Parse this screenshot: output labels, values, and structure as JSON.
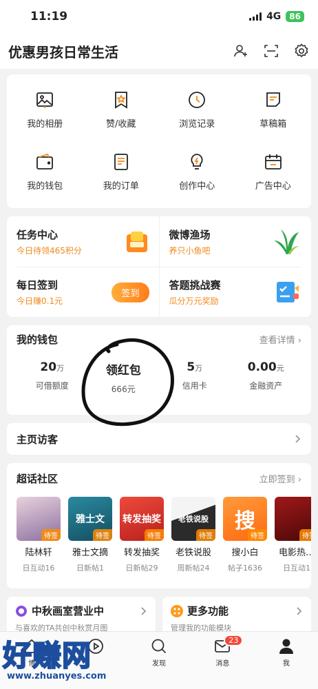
{
  "status": {
    "time": "11:19",
    "network": "4G",
    "battery": "86"
  },
  "header": {
    "title": "优惠男孩日常生活",
    "icons": [
      "add-friend-icon",
      "scan-icon",
      "settings-icon"
    ]
  },
  "grid": [
    [
      {
        "label": "我的相册",
        "icon": "photo-album-icon"
      },
      {
        "label": "赞/收藏",
        "icon": "favorite-icon"
      },
      {
        "label": "浏览记录",
        "icon": "history-icon"
      },
      {
        "label": "草稿箱",
        "icon": "drafts-icon"
      }
    ],
    [
      {
        "label": "我的钱包",
        "icon": "wallet-icon"
      },
      {
        "label": "我的订单",
        "icon": "orders-icon"
      },
      {
        "label": "创作中心",
        "icon": "creator-icon"
      },
      {
        "label": "广告中心",
        "icon": "ad-center-icon"
      }
    ]
  ],
  "tasks": {
    "task_center": {
      "title": "任务中心",
      "sub": "今日待领465积分"
    },
    "fishing": {
      "title": "微博渔场",
      "sub": "养只小鱼吧"
    },
    "checkin": {
      "title": "每日签到",
      "sub": "今日赚0.1元",
      "button": "签到"
    },
    "quiz": {
      "title": "答题挑战赛",
      "sub": "瓜分万元奖励"
    }
  },
  "wallet": {
    "title": "我的钱包",
    "more": "查看详情",
    "items": [
      {
        "value": "20",
        "unit": "万",
        "label": "可借额度"
      },
      {
        "value": "领红包",
        "unit": "",
        "label": "666元"
      },
      {
        "value": "5",
        "unit": "万",
        "label": "信用卡"
      },
      {
        "value": "0.00",
        "unit": "元",
        "label": "金融资产"
      }
    ]
  },
  "visitors": {
    "title": "主页访客"
  },
  "super": {
    "title": "超话社区",
    "more": "立即签到",
    "topics": [
      {
        "name": "陆林轩",
        "sub": "日互动16",
        "tag": "待签",
        "overlay": "",
        "color": "#b59ac0"
      },
      {
        "name": "雅士文摘",
        "sub": "日新帖1",
        "tag": "待签",
        "overlay": "雅士文",
        "color": "#1f6f86"
      },
      {
        "name": "转发抽奖",
        "sub": "日新帖29",
        "tag": "待签",
        "overlay": "转发抽奖",
        "color": "#d8312c"
      },
      {
        "name": "老铁说股",
        "sub": "周新帖24",
        "tag": "待签",
        "overlay": "老铁说股",
        "color": "#2b2b2b"
      },
      {
        "name": "搜小白",
        "sub": "帖子1636",
        "tag": "待签",
        "overlay": "搜",
        "color": "#ff7a1a"
      },
      {
        "name": "电影热…",
        "sub": "日互动1",
        "tag": "待签",
        "overlay": "",
        "color": "#7a1010"
      }
    ]
  },
  "bottom_cards": [
    {
      "title": "中秋画室营业中",
      "sub": "与喜欢的TA共创中秋赏月图"
    },
    {
      "title": "更多功能",
      "sub": "管理我的功能模块"
    }
  ],
  "tabbar": [
    {
      "label": "博",
      "icon": "home-icon"
    },
    {
      "label": "",
      "icon": "video-icon"
    },
    {
      "label": "发现",
      "icon": "discover-icon"
    },
    {
      "label": "消息",
      "icon": "message-icon",
      "badge": "23"
    },
    {
      "label": "我",
      "icon": "profile-icon"
    }
  ],
  "watermark": {
    "text": "好赚网",
    "url": "www.zhuanyes.com"
  },
  "colors": {
    "accent": "#f08a1c",
    "badge": "#f04a3a",
    "watermark": "#1d4e9e"
  }
}
